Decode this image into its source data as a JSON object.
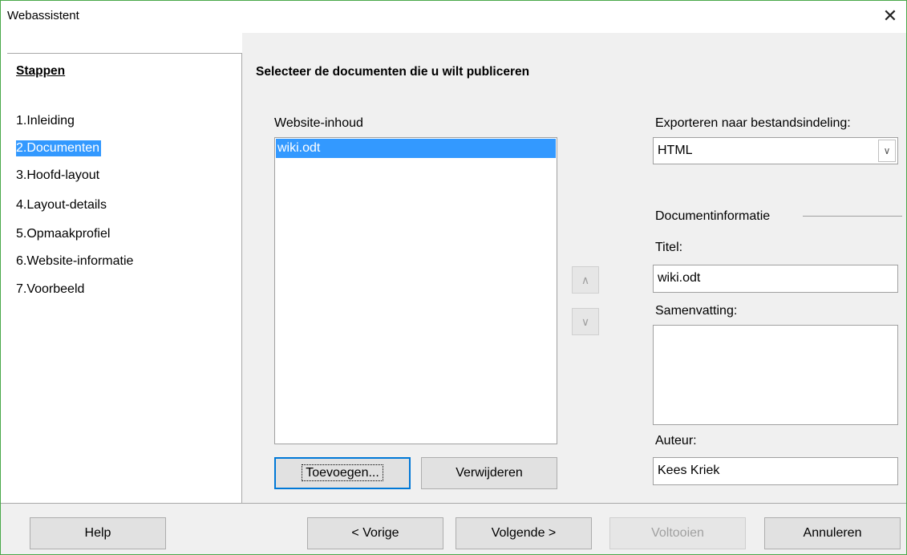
{
  "window": {
    "title": "Webassistent"
  },
  "sidebar": {
    "heading": "Stappen",
    "steps": [
      {
        "num": "1.",
        "label": "Inleiding"
      },
      {
        "num": "2.",
        "label": "Documenten"
      },
      {
        "num": "3.",
        "label": "Hoofd-layout"
      },
      {
        "num": "4.",
        "label": "Layout-details"
      },
      {
        "num": "5.",
        "label": "Opmaakprofiel"
      },
      {
        "num": "6.",
        "label": "Website-informatie"
      },
      {
        "num": "7.",
        "label": "Voorbeeld"
      }
    ],
    "selected_step": "2. Documenten"
  },
  "main": {
    "heading": "Selecteer de documenten die u wilt publiceren",
    "content_list": {
      "label": "Website-inhoud",
      "items": [
        "wiki.odt"
      ],
      "selected": "wiki.odt"
    },
    "add_button": "Toevoegen...",
    "remove_button": "Verwijderen",
    "move_up_icon": "chevron-up-icon",
    "move_down_icon": "chevron-down-icon",
    "export": {
      "label": "Exporteren naar bestandsindeling:",
      "value": "HTML"
    },
    "doc_info": {
      "group_label": "Documentinformatie",
      "title_label": "Titel:",
      "title_value": "wiki.odt",
      "summary_label": "Samenvatting:",
      "summary_value": "",
      "author_label": "Auteur:",
      "author_value": "Kees Kriek"
    }
  },
  "footer": {
    "help": "Help",
    "back": "< Vorige",
    "next": "Volgende >",
    "finish": "Voltooien",
    "cancel": "Annuleren"
  },
  "colors": {
    "selection": "#3399ff",
    "focus_border": "#0078d7",
    "window_border": "#4aa84a"
  }
}
